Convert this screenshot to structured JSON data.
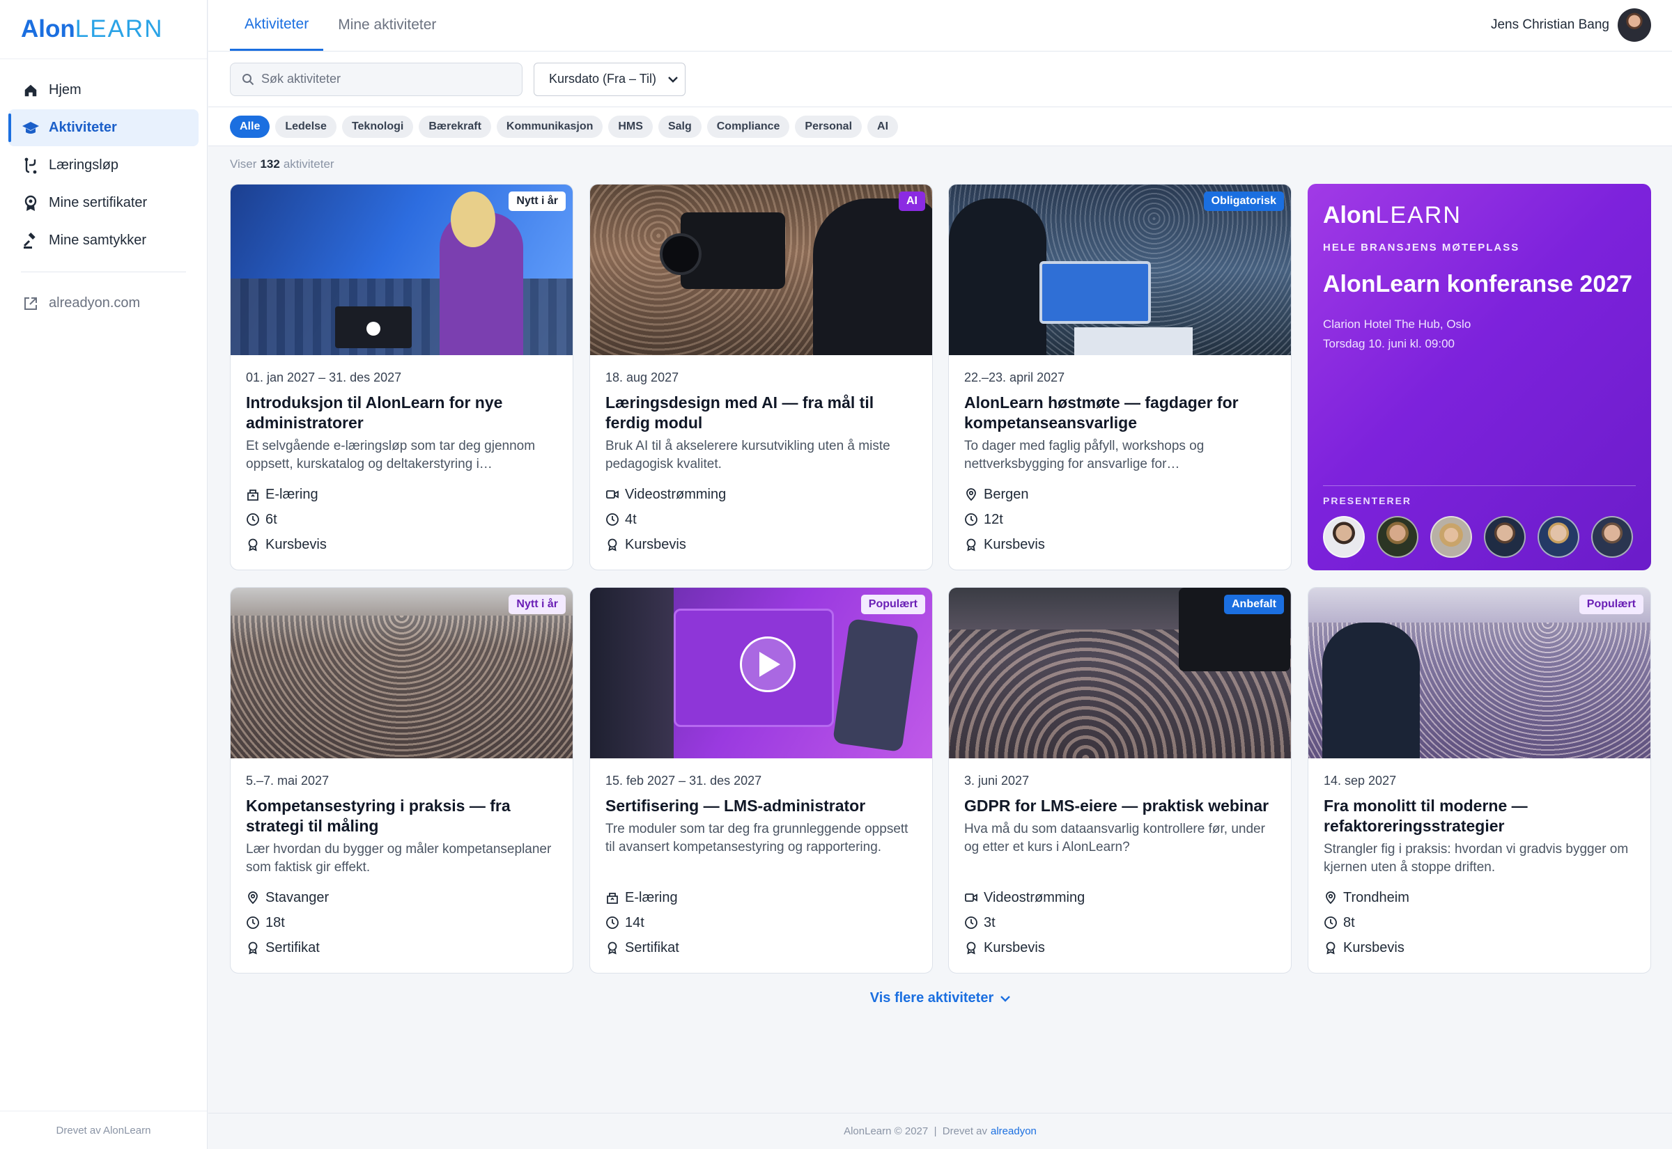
{
  "brand": {
    "logo_bold": "Alon",
    "logo_light": "LEARN",
    "powered": "Drevet av AlonLearn"
  },
  "sidebar": {
    "items": [
      {
        "label": "Hjem",
        "icon": "home-icon"
      },
      {
        "label": "Aktiviteter",
        "icon": "graduation-cap-icon",
        "active": true
      },
      {
        "label": "Læringsløp",
        "icon": "path-icon"
      },
      {
        "label": "Mine sertifikater",
        "icon": "badge-icon"
      },
      {
        "label": "Mine samtykker",
        "icon": "gavel-icon"
      }
    ],
    "external": "alreadyon.com"
  },
  "header": {
    "tabs": [
      "Aktiviteter",
      "Mine aktiviteter"
    ],
    "user_name": "Jens Christian Bang"
  },
  "filters": {
    "search_placeholder": "Søk aktiviteter",
    "sort": "Kursdato (Fra – Til)",
    "chips": [
      "Alle",
      "Ledelse",
      "Teknologi",
      "Bærekraft",
      "Kommunikasjon",
      "HMS",
      "Salg",
      "Compliance",
      "Personal",
      "AI"
    ]
  },
  "count": {
    "prefix": "Viser",
    "value": "132",
    "suffix": "aktiviteter"
  },
  "cards": [
    {
      "badge": "Nytt i år",
      "date": "01. jan 2027 – 31. des 2027",
      "title": "Introduksjon til AlonLearn for nye administratorer",
      "desc": "Et selvgående e-læringsløp som tar deg gjennom oppsett, kurskatalog og deltakerstyring i…",
      "format": "E-læring",
      "duration": "6t",
      "credential": "Kursbevis"
    },
    {
      "badge": "AI",
      "date": "18. aug 2027",
      "title": "Læringsdesign med AI — fra mål til ferdig modul",
      "desc": "Bruk AI til å akselerere kursutvikling uten å miste pedagogisk kvalitet.",
      "format": "Videostrømming",
      "duration": "4t",
      "credential": "Kursbevis"
    },
    {
      "badge": "Obligatorisk",
      "date": "22.–23. april 2027",
      "title": "AlonLearn høstmøte — fagdager for kompetanseansvarlige",
      "desc": "To dager med faglig påfyll, workshops og nettverksbygging for ansvarlige for…",
      "format": "Bergen",
      "duration": "12t",
      "credential": "Kursbevis"
    },
    {
      "badge": "Nytt i år",
      "date": "5.–7. mai 2027",
      "title": "Kompetansestyring i praksis — fra strategi til måling",
      "desc": "Lær hvordan du bygger og måler kompetanseplaner som faktisk gir effekt.",
      "format": "Stavanger",
      "duration": "18t",
      "credential": "Sertifikat"
    },
    {
      "badge": "Populært",
      "date": "15. feb 2027 – 31. des 2027",
      "title": "Sertifisering — LMS-administrator",
      "desc": "Tre moduler som tar deg fra grunnleggende oppsett til avansert kompetansestyring og rapportering.",
      "format": "E-læring",
      "duration": "14t",
      "credential": "Sertifikat"
    },
    {
      "badge": "Anbefalt",
      "date": "3. juni 2027",
      "title": "GDPR for LMS-eiere — praktisk webinar",
      "desc": "Hva må du som dataansvarlig kontrollere før, under og etter et kurs i AlonLearn?",
      "format": "Videostrømming",
      "duration": "3t",
      "credential": "Kursbevis"
    },
    {
      "badge": "Populært",
      "date": "14. sep 2027",
      "title": "Fra monolitt til moderne — refaktoreringsstrategier",
      "desc": "Strangler fig i praksis: hvordan vi gradvis bygger om kjernen uten å stoppe driften.",
      "format": "Trondheim",
      "duration": "8t",
      "credential": "Kursbevis"
    }
  ],
  "promo": {
    "logo_bold": "Alon",
    "logo_light": "LEARN",
    "kicker": "HELE BRANSJENS MØTEPLASS",
    "title": "AlonLearn konferanse 2027",
    "venue": "Clarion Hotel The Hub, Oslo",
    "time": "Torsdag 10. juni kl. 09:00",
    "presenters_label": "PRESENTERER"
  },
  "more": "Vis flere aktiviteter",
  "footer": {
    "text": "AlonLearn © 2027  |  Drevet av",
    "link": "alreadyon"
  },
  "colors": {
    "accent": "#1b6fe0",
    "promo": "#8b2be2"
  }
}
